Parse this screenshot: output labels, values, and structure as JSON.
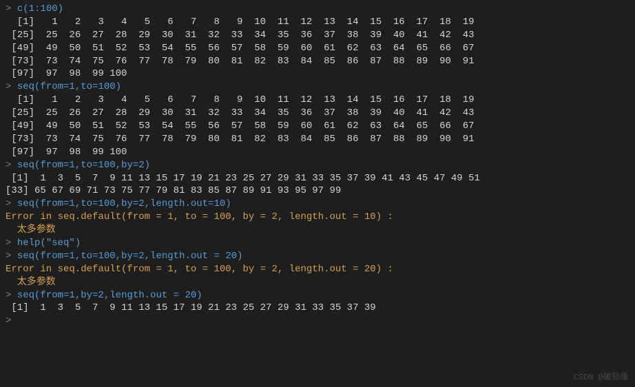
{
  "lines": [
    {
      "t": "cmd",
      "prompt": "> ",
      "code": "c(1:100)"
    },
    {
      "t": "out",
      "text": "  [1]   1   2   3   4   5   6   7   8   9  10  11  12  13  14  15  16  17  18  19"
    },
    {
      "t": "out",
      "text": " [25]  25  26  27  28  29  30  31  32  33  34  35  36  37  38  39  40  41  42  43"
    },
    {
      "t": "out",
      "text": " [49]  49  50  51  52  53  54  55  56  57  58  59  60  61  62  63  64  65  66  67"
    },
    {
      "t": "out",
      "text": " [73]  73  74  75  76  77  78  79  80  81  82  83  84  85  86  87  88  89  90  91"
    },
    {
      "t": "out",
      "text": " [97]  97  98  99 100"
    },
    {
      "t": "cmd",
      "prompt": "> ",
      "code": "seq(from=1,to=100)"
    },
    {
      "t": "out",
      "text": "  [1]   1   2   3   4   5   6   7   8   9  10  11  12  13  14  15  16  17  18  19"
    },
    {
      "t": "out",
      "text": " [25]  25  26  27  28  29  30  31  32  33  34  35  36  37  38  39  40  41  42  43"
    },
    {
      "t": "out",
      "text": " [49]  49  50  51  52  53  54  55  56  57  58  59  60  61  62  63  64  65  66  67"
    },
    {
      "t": "out",
      "text": " [73]  73  74  75  76  77  78  79  80  81  82  83  84  85  86  87  88  89  90  91"
    },
    {
      "t": "out",
      "text": " [97]  97  98  99 100"
    },
    {
      "t": "cmd",
      "prompt": "> ",
      "code": "seq(from=1,to=100,by=2)"
    },
    {
      "t": "out",
      "text": " [1]  1  3  5  7  9 11 13 15 17 19 21 23 25 27 29 31 33 35 37 39 41 43 45 47 49 51"
    },
    {
      "t": "out",
      "text": "[33] 65 67 69 71 73 75 77 79 81 83 85 87 89 91 93 95 97 99"
    },
    {
      "t": "cmd",
      "prompt": "> ",
      "code": "seq(from=1,to=100,by=2,length.out=10)"
    },
    {
      "t": "err",
      "text": "Error in seq.default(from = 1, to = 100, by = 2, length.out = 10) :"
    },
    {
      "t": "err",
      "text": "  太多参数"
    },
    {
      "t": "cmd",
      "prompt": "> ",
      "code": "help(\"seq\")"
    },
    {
      "t": "cmd",
      "prompt": "> ",
      "code": "seq(from=1,to=100,by=2,length.out = 20)"
    },
    {
      "t": "err",
      "text": "Error in seq.default(from = 1, to = 100, by = 2, length.out = 20) :"
    },
    {
      "t": "err",
      "text": "  太多参数"
    },
    {
      "t": "cmd",
      "prompt": "> ",
      "code": "seq(from=1,by=2,length.out = 20)"
    },
    {
      "t": "out",
      "text": " [1]  1  3  5  7  9 11 13 15 17 19 21 23 25 27 29 31 33 35 37 39"
    },
    {
      "t": "cmd",
      "prompt": "> ",
      "code": ""
    }
  ],
  "watermark": "CSDN @破局缘"
}
